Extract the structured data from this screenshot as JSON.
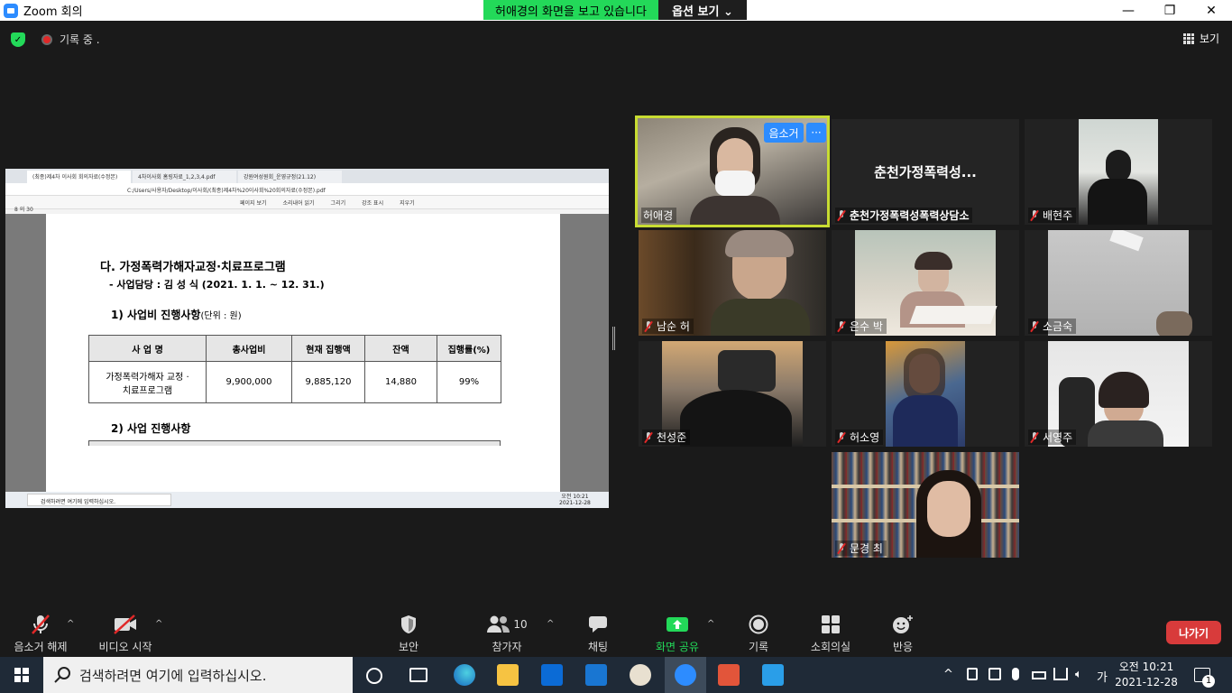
{
  "window": {
    "title": "Zoom 회의"
  },
  "share_banner": {
    "status": "허애경의 화면을 보고 있습니다",
    "view_options": "옵션 보기 ⌄"
  },
  "window_controls": {
    "minimize": "—",
    "restore": "❐",
    "close": "✕"
  },
  "meeting_bar": {
    "recording": "기록 중 .",
    "view": "보기"
  },
  "shared_screen": {
    "tabs": [
      "(최종)제4차 이사회 회의자료(수정본)",
      "4차이사회 홈링자료_1,2,3,4.pdf",
      "강원여성원회_운영규정(21.12)"
    ],
    "address": "C:/Users/사용자/Desktop/이사회/(최종)제4차%20이사회%20회의자료(수정본).pdf",
    "toolbar": [
      "페이지 보기",
      "소리내어 읽기",
      "그리기",
      "강조 표시",
      "지우기"
    ],
    "page_num": "8",
    "page_of": "의 30",
    "heading": "다. 가정폭력가해자교정·치료프로그램",
    "manager": "- 사업담당 : 김 성 식  (2021. 1. 1. ~ 12. 31.)",
    "section1": "1) 사업비 진행사항",
    "section1_unit": "(단위 : 원)",
    "table": {
      "headers": [
        "사 업 명",
        "총사업비",
        "현재 집행액",
        "잔액",
        "집행률(%)"
      ],
      "row": [
        "가정폭력가해자 교정 · 치료프로그램",
        "9,900,000",
        "9,885,120",
        "14,880",
        "99%"
      ]
    },
    "section2": "2) 사업 진행사항",
    "inner_taskbar": {
      "search": "검색하려면 여기에 입력하십시오.",
      "time": "오전 10:21",
      "date": "2021-12-28"
    }
  },
  "participants": [
    {
      "name": "허애경",
      "muted": false,
      "active": true
    },
    {
      "name": "춘천가정폭력성폭력상담소",
      "display": "춘천가정폭력성...",
      "muted": true
    },
    {
      "name": "배현주",
      "muted": true
    },
    {
      "name": "남순 허",
      "muted": true
    },
    {
      "name": "은수 박",
      "muted": true
    },
    {
      "name": "소금숙",
      "muted": true
    },
    {
      "name": "천성준",
      "muted": true
    },
    {
      "name": "허소영",
      "muted": true
    },
    {
      "name": "서영주",
      "muted": true
    },
    {
      "name": "문경 최",
      "muted": true
    }
  ],
  "tile_buttons": {
    "mute": "음소거",
    "more": "···"
  },
  "toolbar": {
    "unmute": "음소거 해제",
    "start_video": "비디오 시작",
    "security": "보안",
    "participants": "참가자",
    "participant_count": "10",
    "chat": "채팅",
    "share_screen": "화면 공유",
    "record": "기록",
    "breakout": "소회의실",
    "reactions": "반응",
    "leave": "나가기"
  },
  "taskbar": {
    "search_placeholder": "검색하려면 여기에 입력하십시오.",
    "ime": "가",
    "time": "오전 10:21",
    "date": "2021-12-28",
    "notifications": "1"
  }
}
